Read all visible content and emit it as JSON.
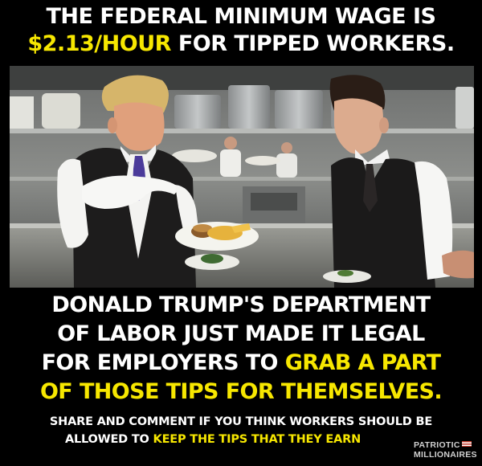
{
  "headline_top": {
    "line1": "THE FEDERAL MINIMUM WAGE IS",
    "line2_highlight": "$2.13/HOUR",
    "line2_rest": " FOR TIPPED WORKERS."
  },
  "headline_bottom": {
    "line1": "DONALD TRUMP'S DEPARTMENT",
    "line2": "OF LABOR JUST MADE IT LEGAL",
    "line3_plain": "FOR EMPLOYERS TO ",
    "line3_highlight": "GRAB A PART",
    "line4_highlight": "OF THOSE TIPS FOR THEMSELVES."
  },
  "call_to_action": {
    "line1": "SHARE AND COMMENT IF YOU THINK WORKERS SHOULD BE",
    "line2_plain": "ALLOWED TO ",
    "line2_highlight": "KEEP THE TIPS THAT THEY EARN"
  },
  "logo": {
    "line1": "PATRIOTIC",
    "line2": "MILLIONAIRES"
  },
  "colors": {
    "background": "#000000",
    "text": "#ffffff",
    "highlight": "#f7e700"
  }
}
